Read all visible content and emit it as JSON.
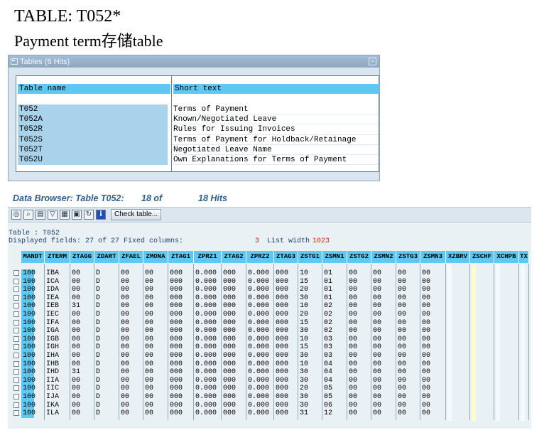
{
  "heading": {
    "line1": "TABLE: T052*",
    "line2": "Payment term存储table"
  },
  "popup": {
    "title": "Tables (6 Hits)",
    "col_name": "Table name",
    "col_text": "Short text",
    "rows": [
      {
        "name": "T052",
        "text": "Terms of Payment"
      },
      {
        "name": "T052A",
        "text": "Known/Negotiated Leave"
      },
      {
        "name": "T052R",
        "text": "Rules for Issuing Invoices"
      },
      {
        "name": "T052S",
        "text": "Terms of Payment for Holdback/Retainage"
      },
      {
        "name": "T052T",
        "text": "Negotiated Leave Name"
      },
      {
        "name": "T052U",
        "text": "Own Explanations for Terms of Payment"
      }
    ]
  },
  "browser": {
    "title_a": "Data Browser: Table T052:",
    "title_b": "18 of",
    "title_c": "18 Hits",
    "check_button": "Check table...",
    "toolbar_icons": [
      "glasses-icon",
      "magnify-icon",
      "print-icon",
      "filter-icon",
      "excel-icon",
      "layout-icon",
      "refresh-icon",
      "info-icon"
    ],
    "meta_table": "Table  : T052",
    "meta_displayed": "Displayed fields:  27 of  27  Fixed columns:",
    "meta_fixed": "3",
    "meta_listwidth_label": "List width",
    "meta_listwidth": "1023",
    "columns": [
      "MANDT",
      "ZTERM",
      "ZTAGG",
      "ZDART",
      "ZFAEL",
      "ZMONA",
      "ZTAG1",
      "ZPRZ1",
      "ZTAG2",
      "ZPRZ2",
      "ZTAG3",
      "ZSTG1",
      "ZSMN1",
      "ZSTG2",
      "ZSMN2",
      "ZSTG3",
      "ZSMN3",
      "XZBRV",
      "ZSCHF",
      "XCHPB",
      "TX"
    ],
    "rows": [
      [
        "100",
        "IBA",
        "00",
        "D",
        "00",
        "00",
        "000",
        "0.000",
        "000",
        "0.000",
        "000",
        "10",
        "01",
        "00",
        "00",
        "00",
        "00"
      ],
      [
        "100",
        "ICA",
        "00",
        "D",
        "00",
        "00",
        "000",
        "0.000",
        "000",
        "0.000",
        "000",
        "15",
        "01",
        "00",
        "00",
        "00",
        "00"
      ],
      [
        "100",
        "IDA",
        "00",
        "D",
        "00",
        "00",
        "000",
        "0.000",
        "000",
        "0.000",
        "000",
        "20",
        "01",
        "00",
        "00",
        "00",
        "00"
      ],
      [
        "100",
        "IEA",
        "00",
        "D",
        "00",
        "00",
        "000",
        "0.000",
        "000",
        "0.000",
        "000",
        "30",
        "01",
        "00",
        "00",
        "00",
        "00"
      ],
      [
        "100",
        "IEB",
        "31",
        "D",
        "00",
        "00",
        "000",
        "0.000",
        "000",
        "0.000",
        "000",
        "10",
        "02",
        "00",
        "00",
        "00",
        "00"
      ],
      [
        "100",
        "IEC",
        "00",
        "D",
        "00",
        "00",
        "000",
        "0.000",
        "000",
        "0.000",
        "000",
        "20",
        "02",
        "00",
        "00",
        "00",
        "00"
      ],
      [
        "100",
        "IFA",
        "00",
        "D",
        "00",
        "00",
        "000",
        "0.000",
        "000",
        "0.000",
        "000",
        "15",
        "02",
        "00",
        "00",
        "00",
        "00"
      ],
      [
        "100",
        "IGA",
        "00",
        "D",
        "00",
        "00",
        "000",
        "0.000",
        "000",
        "0.000",
        "000",
        "30",
        "02",
        "00",
        "00",
        "00",
        "00"
      ],
      [
        "100",
        "IGB",
        "00",
        "D",
        "00",
        "00",
        "000",
        "0.000",
        "000",
        "0.000",
        "000",
        "10",
        "03",
        "00",
        "00",
        "00",
        "00"
      ],
      [
        "100",
        "IGH",
        "00",
        "D",
        "00",
        "00",
        "000",
        "0.000",
        "000",
        "0.000",
        "000",
        "15",
        "03",
        "00",
        "00",
        "00",
        "00"
      ],
      [
        "100",
        "IHA",
        "00",
        "D",
        "00",
        "00",
        "000",
        "0.000",
        "000",
        "0.000",
        "000",
        "30",
        "03",
        "00",
        "00",
        "00",
        "00"
      ],
      [
        "100",
        "IHB",
        "00",
        "D",
        "00",
        "00",
        "000",
        "0.000",
        "000",
        "0.000",
        "000",
        "10",
        "04",
        "00",
        "00",
        "00",
        "00"
      ],
      [
        "100",
        "IHD",
        "31",
        "D",
        "00",
        "00",
        "000",
        "0.000",
        "000",
        "0.000",
        "000",
        "30",
        "04",
        "00",
        "00",
        "00",
        "00"
      ],
      [
        "100",
        "IIA",
        "00",
        "D",
        "00",
        "00",
        "000",
        "0.000",
        "000",
        "0.000",
        "000",
        "30",
        "04",
        "00",
        "00",
        "00",
        "00"
      ],
      [
        "100",
        "IIC",
        "00",
        "D",
        "00",
        "00",
        "000",
        "0.000",
        "000",
        "0.000",
        "000",
        "20",
        "05",
        "00",
        "00",
        "00",
        "00"
      ],
      [
        "100",
        "IJA",
        "00",
        "D",
        "00",
        "00",
        "000",
        "0.000",
        "000",
        "0.000",
        "000",
        "30",
        "05",
        "00",
        "00",
        "00",
        "00"
      ],
      [
        "100",
        "IKA",
        "00",
        "D",
        "00",
        "00",
        "000",
        "0.000",
        "000",
        "0.000",
        "000",
        "30",
        "06",
        "00",
        "00",
        "00",
        "00"
      ],
      [
        "100",
        "ILA",
        "00",
        "D",
        "00",
        "00",
        "000",
        "0.000",
        "000",
        "0.000",
        "000",
        "31",
        "12",
        "00",
        "00",
        "00",
        "00"
      ]
    ]
  }
}
